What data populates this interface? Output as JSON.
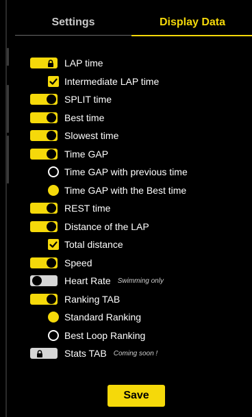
{
  "tabs": [
    {
      "label": "Settings",
      "active": false
    },
    {
      "label": "Display Data",
      "active": true
    }
  ],
  "rows": [
    {
      "kind": "toggle",
      "state": "locked-on",
      "label": "LAP time",
      "icon": "lock-icon"
    },
    {
      "kind": "checkbox",
      "checked": true,
      "label": "Intermediate LAP time"
    },
    {
      "kind": "toggle",
      "state": "on",
      "label": "SPLIT time"
    },
    {
      "kind": "toggle",
      "state": "on",
      "label": "Best time"
    },
    {
      "kind": "toggle",
      "state": "on",
      "label": "Slowest time"
    },
    {
      "kind": "toggle",
      "state": "on",
      "label": "Time GAP"
    },
    {
      "kind": "radio",
      "selected": false,
      "label": "Time GAP with previous time"
    },
    {
      "kind": "radio",
      "selected": true,
      "label": "Time GAP with the Best time"
    },
    {
      "kind": "toggle",
      "state": "on",
      "label": "REST time"
    },
    {
      "kind": "toggle",
      "state": "on",
      "label": "Distance of the LAP"
    },
    {
      "kind": "checkbox",
      "checked": true,
      "label": "Total distance"
    },
    {
      "kind": "toggle",
      "state": "on",
      "label": "Speed"
    },
    {
      "kind": "toggle",
      "state": "off",
      "label": "Heart Rate",
      "note": "Swimming only"
    },
    {
      "kind": "toggle",
      "state": "on",
      "label": "Ranking TAB"
    },
    {
      "kind": "radio",
      "selected": true,
      "label": "Standard Ranking"
    },
    {
      "kind": "radio",
      "selected": false,
      "label": "Best Loop Ranking"
    },
    {
      "kind": "toggle",
      "state": "locked-off",
      "label": "Stats TAB",
      "note": "Coming soon !",
      "icon": "lock-icon"
    }
  ],
  "save_label": "Save",
  "colors": {
    "accent": "#f5d90a",
    "background": "#000000",
    "toggle_off": "#d6d6d6",
    "text": "#ffffff"
  }
}
